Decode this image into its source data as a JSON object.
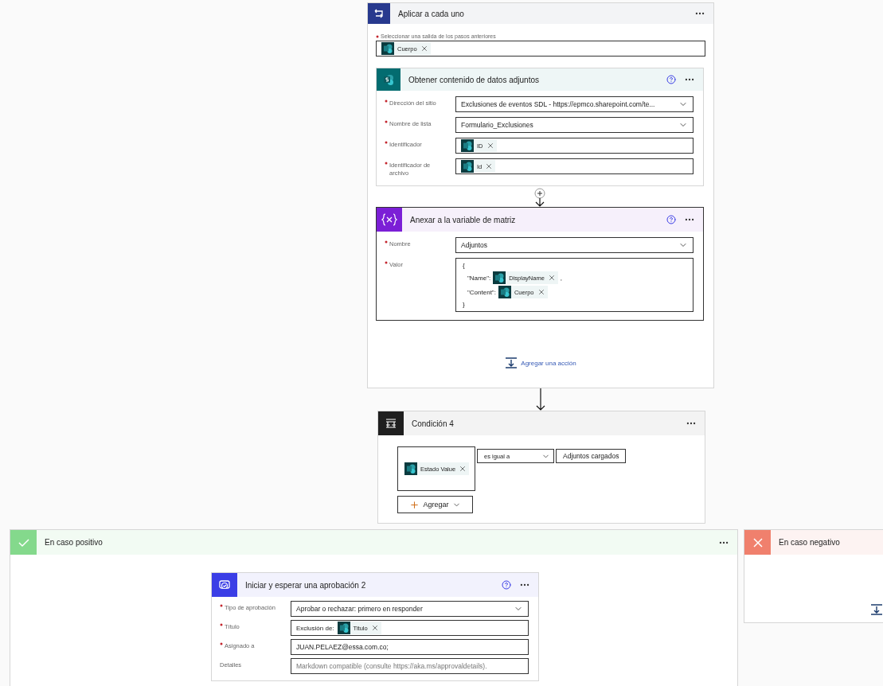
{
  "apply_each": {
    "title": "Aplicar a cada uno",
    "output_label": "Seleccionar una salida de los pasos anteriores",
    "output_required": true,
    "output_tokens": [
      "Cuerpo"
    ],
    "actions": [
      {
        "kind": "sharepoint",
        "title": "Obtener contenido de datos adjuntos",
        "fields": [
          {
            "kind": "dropdown",
            "label": "Dirección del sitio",
            "required": true,
            "value": "Exclusiones de eventos SDL - https://epmco.sharepoint.com/te..."
          },
          {
            "kind": "dropdown",
            "label": "Nombre de lista",
            "required": true,
            "value": "Formulario_Exclusiones"
          },
          {
            "kind": "parts",
            "label": "Identificador",
            "required": true,
            "parts": [
              {
                "token": "ID"
              }
            ]
          },
          {
            "kind": "parts",
            "label": "Identificador de archivo",
            "required": true,
            "parts": [
              {
                "token": "Id"
              }
            ]
          }
        ]
      },
      {
        "kind": "variable",
        "title": "Anexar a la variable de matriz",
        "fields": [
          {
            "kind": "dropdown",
            "label": "Nombre",
            "required": true,
            "value": "Adjuntos"
          },
          {
            "kind": "code",
            "label": "Valor",
            "required": true,
            "lines": [
              [
                {
                  "text": "{"
                }
              ],
              [
                {
                  "text": "\"Name\":"
                },
                {
                  "token": "DisplayName"
                },
                {
                  "text": ","
                }
              ],
              [
                {
                  "text": "\"Content\":"
                },
                {
                  "token": "Cuerpo"
                }
              ],
              [
                {
                  "text": "}"
                }
              ]
            ]
          }
        ]
      }
    ],
    "add_action": "Agregar una acción"
  },
  "condition": {
    "title": "Condición 4",
    "left_token": "Estado Value",
    "operator": "es igual a",
    "right_value": "Adjuntos cargados",
    "add_button": "Agregar"
  },
  "branches": [
    {
      "kind": "positive",
      "title": "En caso positivo",
      "actions": [
        {
          "kind": "approval",
          "title": "Iniciar y esperar una aprobación 2",
          "fields": [
            {
              "kind": "dropdown",
              "label": "Tipo de aprobación",
              "required": true,
              "value": "Aprobar o rechazar: primero en responder"
            },
            {
              "kind": "parts",
              "label": "Título",
              "required": true,
              "parts": [
                {
                  "text": "Exclusión de:"
                },
                {
                  "token": "Titulo"
                }
              ]
            },
            {
              "kind": "text",
              "label": "Asignado a",
              "required": true,
              "value": "JUAN.PELAEZ@essa.com.co;"
            },
            {
              "kind": "placeholder",
              "label": "Detalles",
              "required": false,
              "placeholder": "Markdown compatible (consulte https://aka.ms/approvaldetails)."
            }
          ]
        }
      ]
    },
    {
      "kind": "negative",
      "title": "En caso negativo"
    }
  ]
}
